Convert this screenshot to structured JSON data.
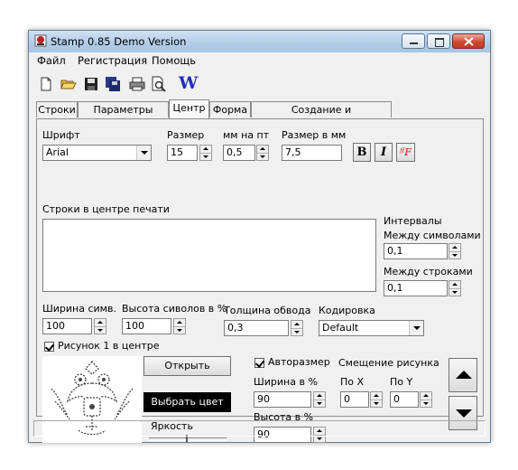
{
  "window": {
    "title": "Stamp 0.85 Demo Version"
  },
  "menu": {
    "items": [
      "Файл",
      "Регистрация",
      "Помощь"
    ]
  },
  "toolbar": {
    "icons": [
      "new-document-icon",
      "open-folder-icon",
      "save-icon",
      "save-all-icon",
      "print-icon",
      "print-preview-icon",
      "word-export-icon"
    ],
    "word_label": "W"
  },
  "tabs": {
    "items": [
      "Строки",
      "Параметры строк",
      "Центр",
      "Форма",
      "Создание и редактирование"
    ],
    "active": "Центр"
  },
  "font": {
    "font_label": "Шрифт",
    "font_value": "Arial",
    "size_label": "Размер",
    "size_value": "15",
    "mm_per_pt_label": "мм на пт",
    "mm_per_pt_value": "0,5",
    "size_mm_label": "Размер в мм",
    "size_mm_value": "7,5",
    "bold_label": "B",
    "italic_label": "I",
    "fancy_label": "ᶠᶠF"
  },
  "center_lines": {
    "label": "Строки в центре печати"
  },
  "intervals": {
    "title": "Интервалы",
    "between_chars_label": "Между символами",
    "between_chars_value": "0,1",
    "between_lines_label": "Между строками",
    "between_lines_value": "0,1"
  },
  "params": {
    "char_width_label": "Ширина симв.",
    "char_width_value": "100",
    "char_height_label": "Высота сиволов в %",
    "char_height_value": "100",
    "stroke_label": "Толщина обвода",
    "stroke_value": "0,3",
    "encoding_label": "Кодировка",
    "encoding_value": "Default"
  },
  "picture": {
    "checkbox_label": "Рисунок 1 в центре",
    "open_button": "Открыть",
    "choose_color_button": "Выбрать цвет",
    "brightness_label": "Яркость",
    "autosize_label": "Авторазмер",
    "offset_label": "Смещение рисунка",
    "width_pct_label": "Ширина в %",
    "width_pct_value": "90",
    "height_pct_label": "Высота в %",
    "height_pct_value": "90",
    "offset_x_label": "По X",
    "offset_x_value": "0",
    "offset_y_label": "По Y",
    "offset_y_value": "0"
  },
  "colors": {
    "window_bg": "#f0f0f0",
    "title_gradient": "#b3cde8",
    "color_button_bg": "#000000",
    "color_button_text": "#ffffff",
    "word_blue": "#1f2fb8",
    "fancy_red": "#c01818"
  }
}
